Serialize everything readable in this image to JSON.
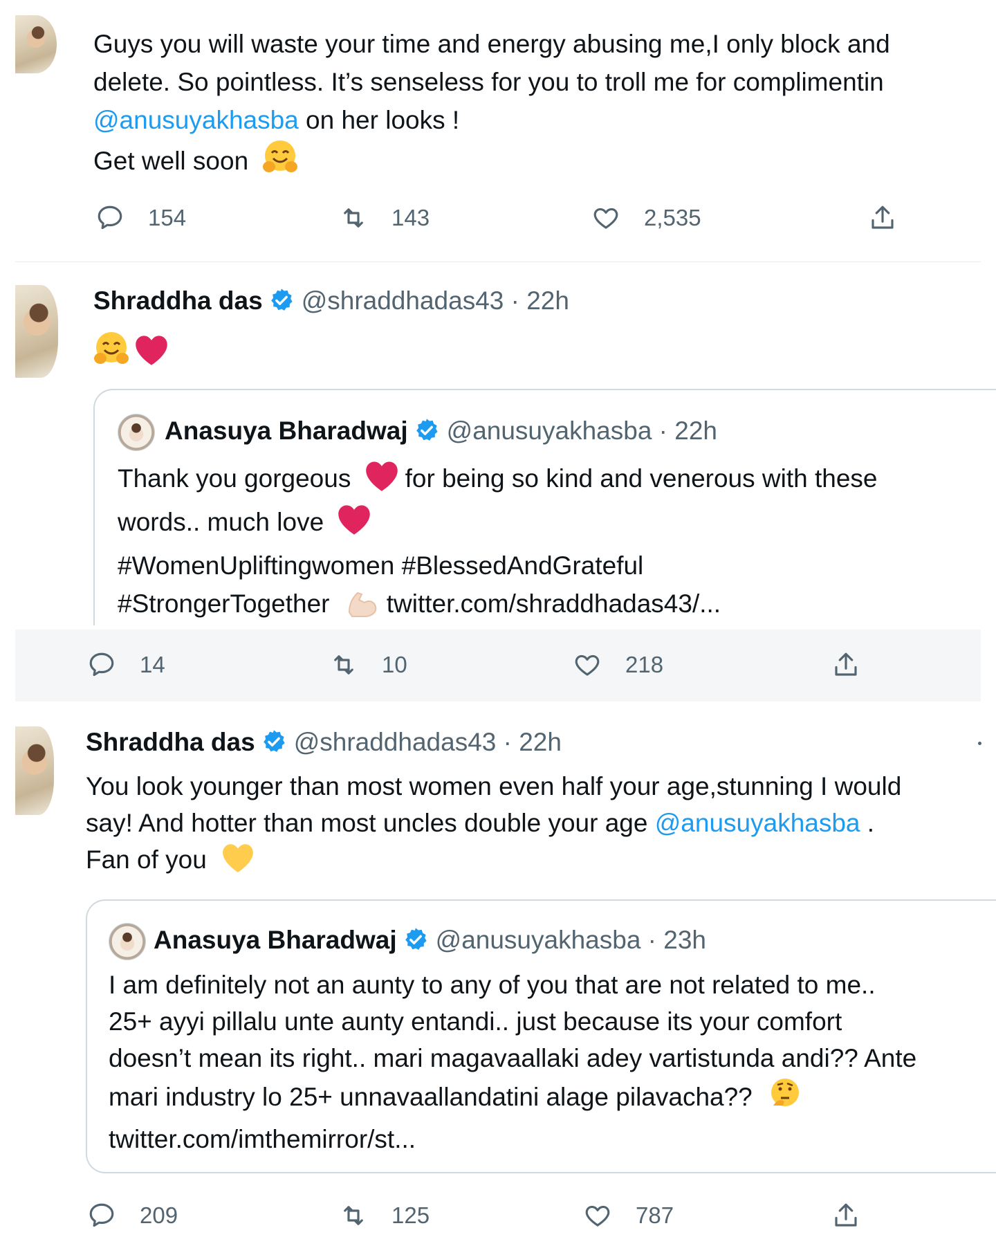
{
  "tweet1": {
    "line1": "Guys you will waste your time and energy abusing me,I only block and",
    "line2": "delete. So pointless. It’s senseless for you to troll me for complimentin",
    "mention": "@anusuyakhasba",
    "line3_rest": " on her looks !",
    "line4": "Get well soon",
    "emoji": "hugging-face",
    "replies": "154",
    "retweets": "143",
    "likes": "2,535"
  },
  "tweet2": {
    "author_name": "Shraddha das",
    "handle_time": "@shraddhadas43 · 22h",
    "emojis": [
      "hugging-face",
      "red-heart"
    ],
    "quote": {
      "author_name": "Anasuya Bharadwaj",
      "handle_time": "@anusuyakhasba · 22h",
      "line1_a": "Thank you gorgeous",
      "line1_b": "for being so kind and venerous with these",
      "line2": "words.. much love",
      "line3": "#WomenUpliftingwomen #BlessedAndGrateful",
      "line4_a": "#StrongerTogether",
      "line4_link": "twitter.com/shraddhadas43/..."
    },
    "replies": "14",
    "retweets": "10",
    "likes": "218"
  },
  "tweet3": {
    "author_name": "Shraddha das",
    "handle_time": "@shraddhadas43 · 22h",
    "line1": "You look younger than most women even half your age,stunning I would",
    "line2_a": "say! And hotter than most uncles double your age ",
    "mention": "@anusuyakhasba",
    "line2_b": " .",
    "line3": "Fan of you",
    "emoji": "yellow-heart",
    "quote": {
      "author_name": "Anasuya Bharadwaj",
      "handle_time": "@anusuyakhasba · 23h",
      "line1": "I am definitely not an aunty to any of you that are not related to me..",
      "line2": "25+ ayyi pillalu unte aunty entandi.. just because its your comfort",
      "line3": "doesn’t mean its right.. mari magavaallaki adey vartistunda andi?? Ante",
      "line4": "mari industry lo 25+ unnavaallandatini alage pilavacha??",
      "line5": "twitter.com/imthemirror/st..."
    },
    "replies": "209",
    "retweets": "125",
    "likes": "787"
  },
  "colors": {
    "link": "#1d9bf0",
    "muted": "#536471",
    "verified": "#1d9bf0",
    "heart": "#e0245e"
  }
}
